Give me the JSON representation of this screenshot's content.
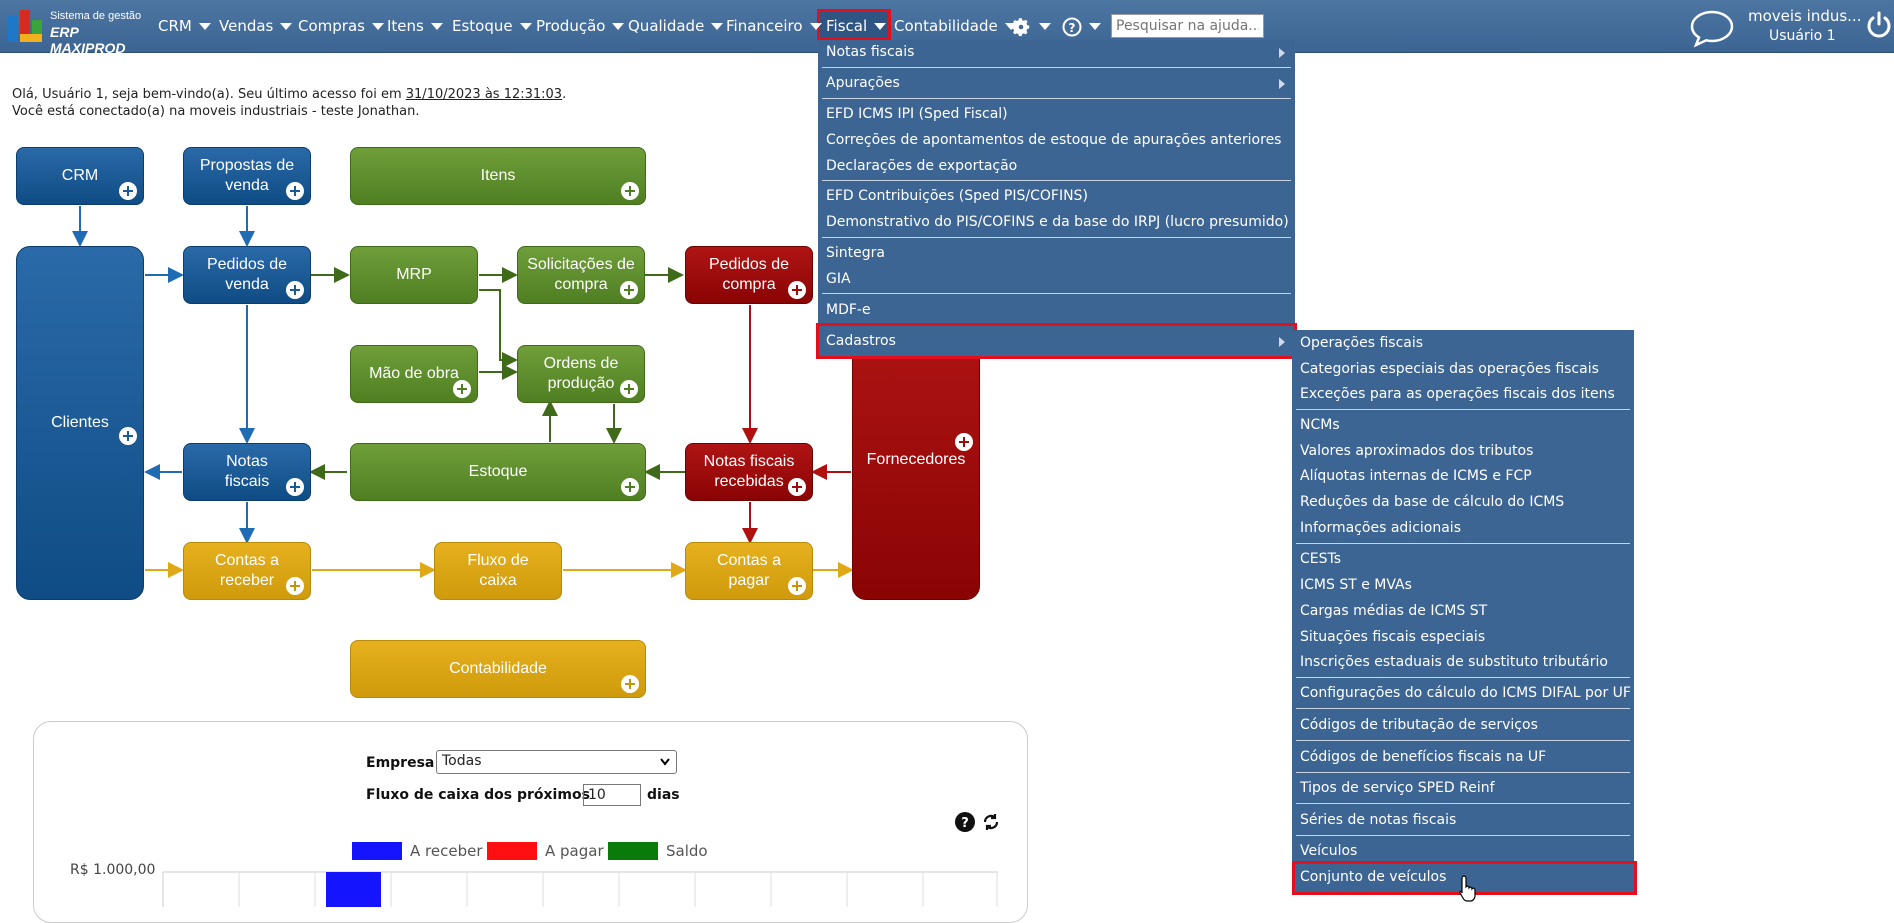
{
  "app": {
    "logo_line1": "Sistema de gestão",
    "logo_line2": "ERP MAXIPROD"
  },
  "nav": {
    "items": [
      "CRM",
      "Vendas",
      "Compras",
      "Itens",
      "Estoque",
      "Produção",
      "Qualidade",
      "Financeiro",
      "Fiscal",
      "Contabilidade"
    ],
    "search_placeholder": "Pesquisar na ajuda...",
    "user_company": "moveis indus...",
    "user_name": "Usuário 1"
  },
  "greeting": {
    "line1_prefix": "Olá, Usuário 1, seja bem-vindo(a). Seu último acesso foi em ",
    "last_access": "31/10/2023 às 12:31:03",
    "line1_suffix": ".",
    "line2": "Você está conectado(a) na moveis industriais - teste Jonathan."
  },
  "flow": {
    "crm": "CRM",
    "propostas": "Propostas de venda",
    "itens": "Itens",
    "clientes": "Clientes",
    "pedidos_venda": "Pedidos de venda",
    "mrp": "MRP",
    "solicitacoes": "Solicitações de compra",
    "pedidos_compra": "Pedidos de compra",
    "mao_obra": "Mão de obra",
    "ordens": "Ordens de produção",
    "fornecedores": "Fornecedores",
    "notas_fiscais": "Notas fiscais",
    "estoque": "Estoque",
    "nf_recebidas": "Notas fiscais recebidas",
    "contas_receber": "Contas a receber",
    "fluxo_caixa": "Fluxo de caixa",
    "contas_pagar": "Contas a pagar",
    "contabilidade": "Contabilidade"
  },
  "cashflow": {
    "empresa_label": "Empresa",
    "empresa_value": "Todas",
    "fluxo_label": "Fluxo de caixa dos próximos",
    "dias_value": "10",
    "dias_label": "dias",
    "legend": [
      {
        "label": "A receber",
        "color": "#1414ff"
      },
      {
        "label": "A pagar",
        "color": "#ff0f0f"
      },
      {
        "label": "Saldo",
        "color": "#0a7a0a"
      }
    ],
    "y_tick": "R$ 1.000,00"
  },
  "fiscal_menu": {
    "items": [
      "Notas fiscais",
      "Apurações",
      "EFD ICMS IPI (Sped Fiscal)",
      "Correções de apontamentos de estoque de apurações anteriores",
      "Declarações de exportação",
      "EFD Contribuições (Sped PIS/COFINS)",
      "Demonstrativo do PIS/COFINS e da base do IRPJ (lucro presumido)",
      "Sintegra",
      "GIA",
      "MDF-e",
      "Cadastros"
    ]
  },
  "cadastros_menu": {
    "items": [
      "Operações fiscais",
      "Categorias especiais das operações fiscais",
      "Exceções para as operações fiscais dos itens",
      "NCMs",
      "Valores aproximados dos tributos",
      "Alíquotas internas de ICMS e FCP",
      "Reduções da base de cálculo do ICMS",
      "Informações adicionais",
      "CESTs",
      "ICMS ST e MVAs",
      "Cargas médias de ICMS ST",
      "Situações fiscais especiais",
      "Inscrições estaduais de substituto tributário",
      "Configurações do cálculo do ICMS DIFAL por UF",
      "Códigos de tributação de serviços",
      "Códigos de benefícios fiscais na UF",
      "Tipos de serviço SPED Reinf",
      "Séries de notas fiscais",
      "Veículos",
      "Conjunto de veículos"
    ]
  }
}
